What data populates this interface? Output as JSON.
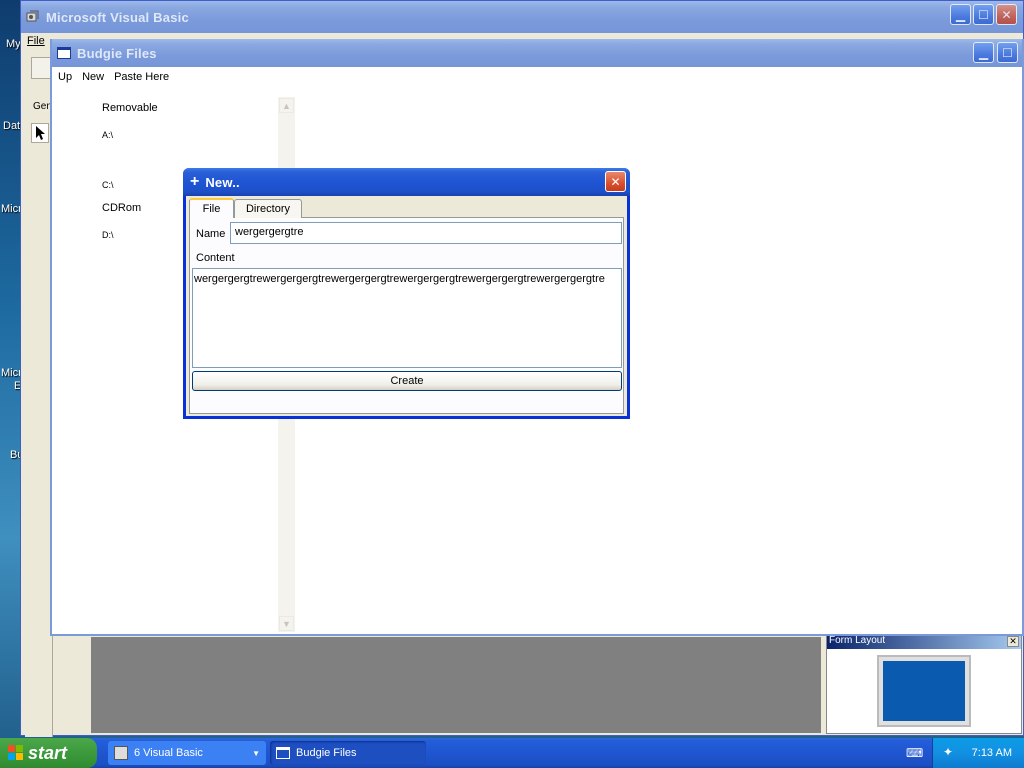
{
  "desktop": {
    "fragments": [
      "My",
      "Dat",
      "Micr",
      "Micr",
      "E",
      "Bu"
    ]
  },
  "vb_window": {
    "title": "Microsoft Visual Basic",
    "menu_fragment": "File",
    "toolbox_tab": "Gen",
    "icon": "vb-icon"
  },
  "budgie_window": {
    "title": "Budgie Files",
    "menu": [
      "Up",
      "New",
      "Paste Here"
    ],
    "tree": {
      "removable_label": "Removable",
      "drive_a": "A:\\",
      "drive_c": "C:\\",
      "cdrom_label": "CDRom",
      "drive_d": "D:\\"
    }
  },
  "form_layout": {
    "title": "Form Layout"
  },
  "new_dialog": {
    "title": "New..",
    "title_icon": "plus-icon",
    "tabs": [
      "File",
      "Directory"
    ],
    "active_tab": "File",
    "name_label": "Name",
    "name_value": "wergergergtre",
    "content_label": "Content",
    "content_value": "wergergergtrewergergergtrewergergergtrewergergergtrewergergergtrewergergergtre",
    "create_button": "Create"
  },
  "taskbar": {
    "start_label": "start",
    "tasks": [
      {
        "label": "6 Visual Basic",
        "icon": "vb-icon",
        "group_arrow": "chevron-down-icon"
      },
      {
        "label": "Budgie Files",
        "icon": "window-icon"
      }
    ],
    "clock": "7:13 AM"
  },
  "colors": {
    "xp_title_blue": "#1f55d4",
    "xp_close_red": "#d9502f",
    "dialog_face": "#ece9d8",
    "taskbar_blue": "#245edb",
    "start_green": "#3c9a3c"
  }
}
